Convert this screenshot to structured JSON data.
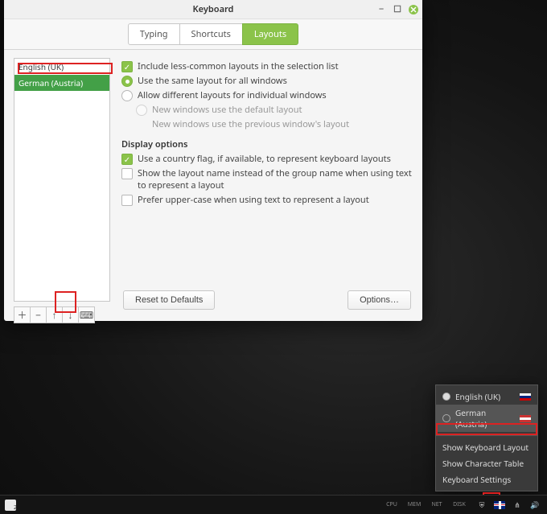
{
  "window": {
    "title": "Keyboard",
    "tabs": [
      {
        "label": "Typing",
        "active": false
      },
      {
        "label": "Shortcuts",
        "active": false
      },
      {
        "label": "Layouts",
        "active": true
      }
    ]
  },
  "layout_list": {
    "items": [
      {
        "label": "English (UK)",
        "selected": false
      },
      {
        "label": "German (Austria)",
        "selected": true
      }
    ]
  },
  "toolbar_icons": {
    "add": "＋",
    "remove": "−",
    "up": "↑",
    "down": "↓",
    "preview": "⌨"
  },
  "options": {
    "include_less_common": "Include less-common layouts in the selection list",
    "same_all_windows": "Use the same layout for all windows",
    "diff_per_window": "Allow different layouts for individual windows",
    "new_default": "New windows use the default layout",
    "new_previous": "New windows use the previous window's layout",
    "display_heading": "Display options",
    "use_flag": "Use a country flag, if available, to represent keyboard layouts",
    "show_layout_name": "Show the layout name instead of the group name when using text to represent a layout",
    "prefer_uppercase": "Prefer upper-case when using text to represent a layout",
    "reset_btn": "Reset to Defaults",
    "options_btn": "Options…"
  },
  "tray_menu": {
    "items": [
      {
        "label": "English (UK)",
        "selected": true,
        "flag": "uk"
      },
      {
        "label": "German (Austria)",
        "selected": false,
        "flag": "at"
      }
    ],
    "actions": [
      "Show Keyboard Layout",
      "Show Character Table",
      "Keyboard Settings"
    ]
  },
  "taskbar": {
    "monitors": [
      {
        "name": "CPU",
        "val": ""
      },
      {
        "name": "MEM",
        "val": ""
      },
      {
        "name": "NET",
        "val": ""
      },
      {
        "name": "DISK",
        "val": ""
      }
    ]
  }
}
